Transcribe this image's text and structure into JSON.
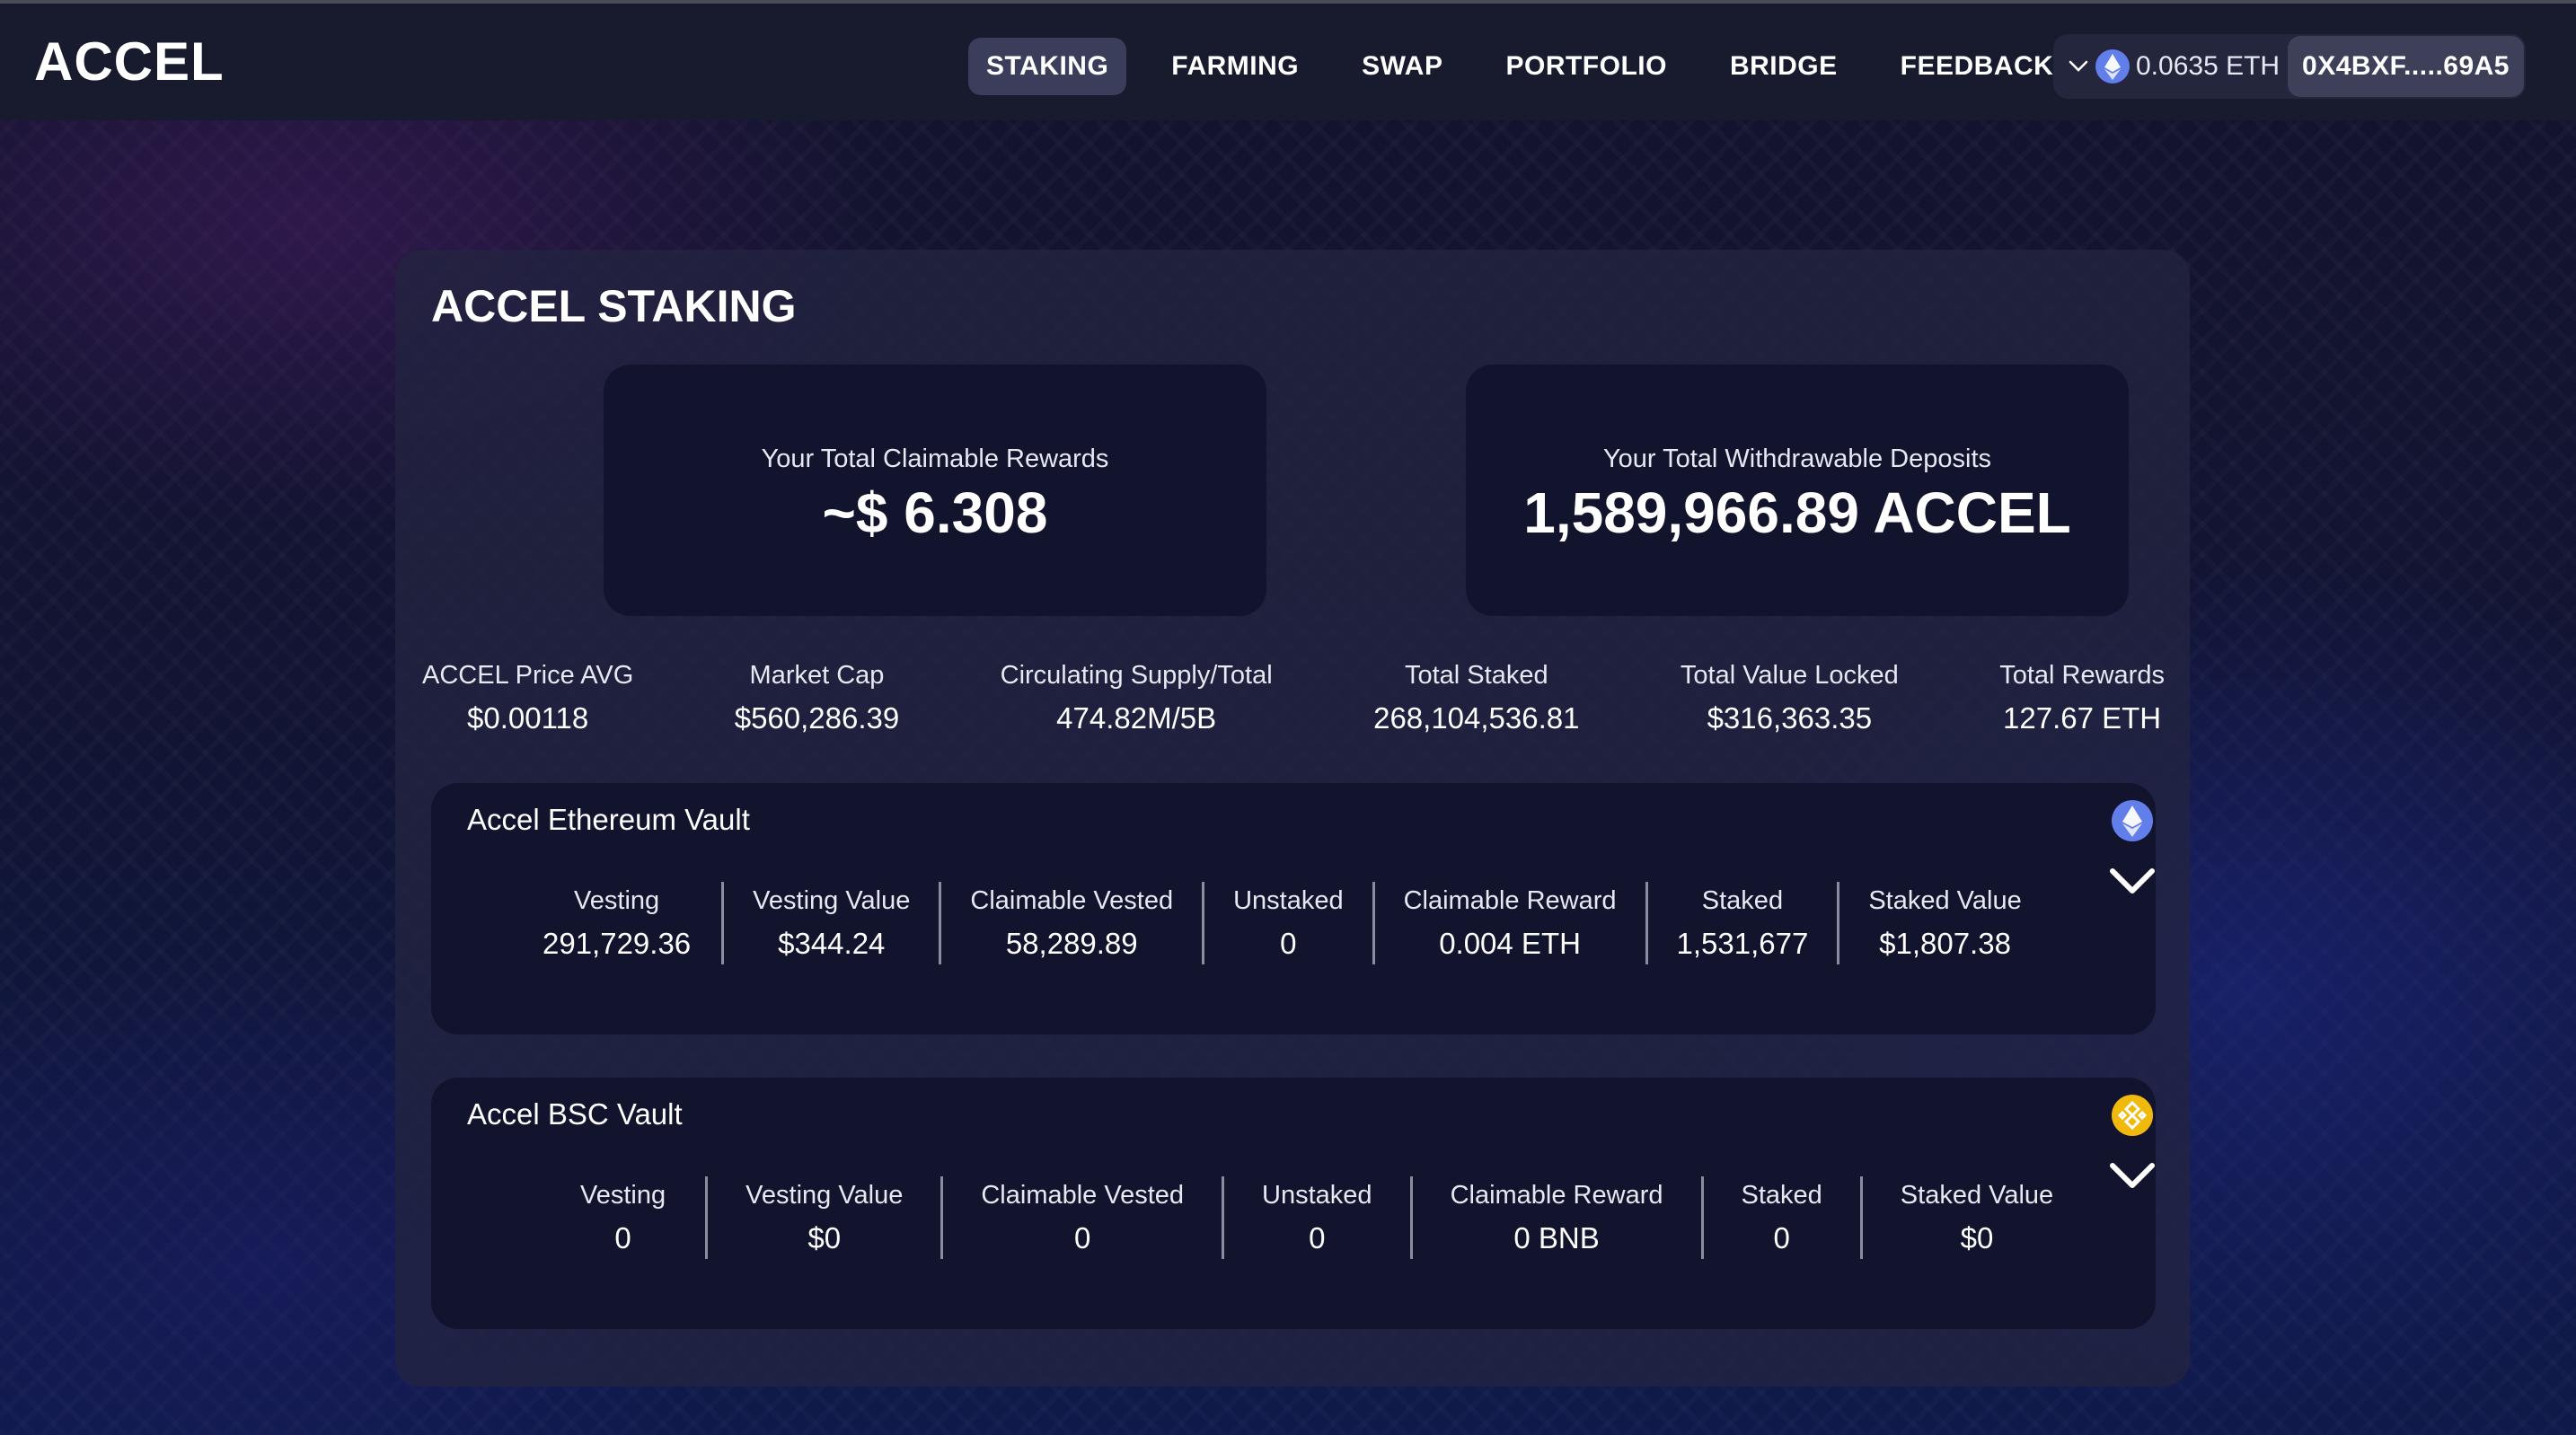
{
  "app": {
    "logo_text": "ACCEL"
  },
  "nav": {
    "items": [
      {
        "label": "STAKING",
        "active": true
      },
      {
        "label": "FARMING",
        "active": false
      },
      {
        "label": "SWAP",
        "active": false
      },
      {
        "label": "PORTFOLIO",
        "active": false
      },
      {
        "label": "BRIDGE",
        "active": false
      },
      {
        "label": "FEEDBACK",
        "active": false
      }
    ]
  },
  "wallet": {
    "balance": "0.0635 ETH",
    "address": "0X4BXF.....69A5",
    "chain_icon": "ethereum-icon",
    "dropdown_icon": "chevron-down-icon"
  },
  "page": {
    "title": "ACCEL STAKING",
    "claimable_rewards": {
      "label": "Your Total Claimable Rewards",
      "value": "~$ 6.308"
    },
    "withdrawable_deposits": {
      "label": "Your Total Withdrawable Deposits",
      "value": "1,589,966.89 ACCEL"
    },
    "stats": [
      {
        "label": "ACCEL Price AVG",
        "value": "$0.00118"
      },
      {
        "label": "Market Cap",
        "value": "$560,286.39"
      },
      {
        "label": "Circulating Supply/Total",
        "value": "474.82M/5B"
      },
      {
        "label": "Total Staked",
        "value": "268,104,536.81"
      },
      {
        "label": "Total Value Locked",
        "value": "$316,363.35"
      },
      {
        "label": "Total Rewards",
        "value": "127.67 ETH"
      }
    ]
  },
  "vaults": [
    {
      "title": "Accel Ethereum Vault",
      "icon": "ethereum-icon",
      "columns": [
        {
          "label": "Vesting",
          "value": "291,729.36"
        },
        {
          "label": "Vesting Value",
          "value": "$344.24"
        },
        {
          "label": "Claimable Vested",
          "value": "58,289.89"
        },
        {
          "label": "Unstaked",
          "value": "0"
        },
        {
          "label": "Claimable Reward",
          "value": "0.004 ETH"
        },
        {
          "label": "Staked",
          "value": "1,531,677"
        },
        {
          "label": "Staked Value",
          "value": "$1,807.38"
        }
      ]
    },
    {
      "title": "Accel BSC Vault",
      "icon": "bnb-icon",
      "columns": [
        {
          "label": "Vesting",
          "value": "0"
        },
        {
          "label": "Vesting Value",
          "value": "$0"
        },
        {
          "label": "Claimable Vested",
          "value": "0"
        },
        {
          "label": "Unstaked",
          "value": "0"
        },
        {
          "label": "Claimable Reward",
          "value": "0 BNB"
        },
        {
          "label": "Staked",
          "value": "0"
        },
        {
          "label": "Staked Value",
          "value": "$0"
        }
      ]
    }
  ],
  "colors": {
    "topbar": "#181b2e",
    "panel": "#222440",
    "card": "#12142d",
    "nav_active": "#3b3e5a",
    "eth": "#627eea",
    "bnb": "#f0b90b"
  }
}
